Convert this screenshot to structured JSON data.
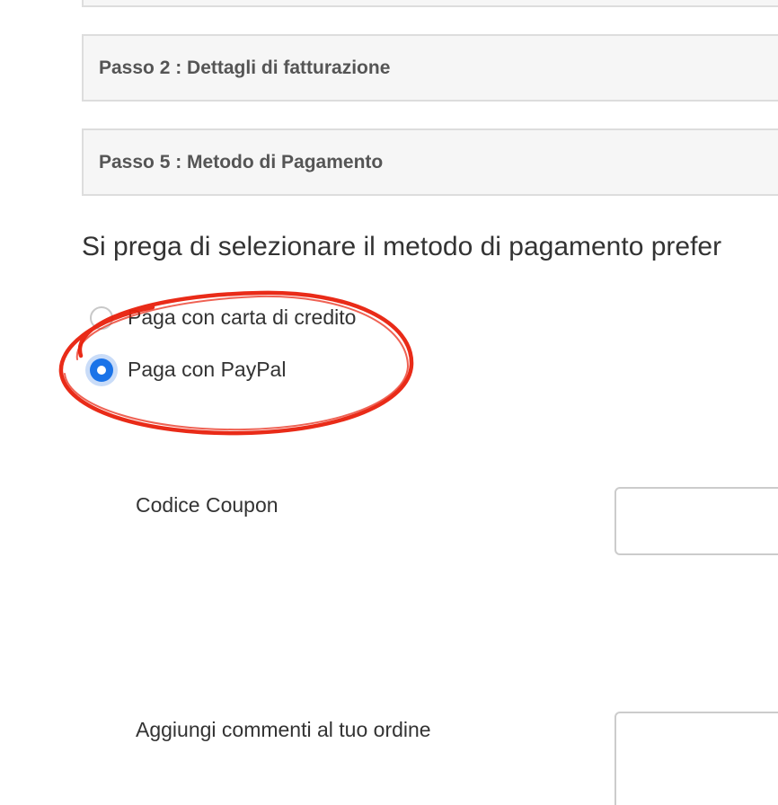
{
  "steps": {
    "step2_title": "Passo 2 : Dettagli di fatturazione",
    "step5_title": "Passo 5 : Metodo di Pagamento"
  },
  "payment": {
    "instruction": "Si prega di selezionare il metodo di pagamento prefer",
    "options": [
      {
        "label": "Paga con carta di credito",
        "checked": false
      },
      {
        "label": "Paga con PayPal",
        "checked": true
      }
    ]
  },
  "form": {
    "coupon_label": "Codice Coupon",
    "coupon_value": "",
    "comments_label": "Aggiungi commenti al tuo ordine",
    "comments_value": ""
  },
  "colors": {
    "radio_selected": "#1a73e8",
    "annotation_ring": "#e8200c",
    "panel_background": "#f6f6f6"
  },
  "annotation": {
    "type": "hand-drawn-ellipse",
    "highlights": "payment-options"
  }
}
